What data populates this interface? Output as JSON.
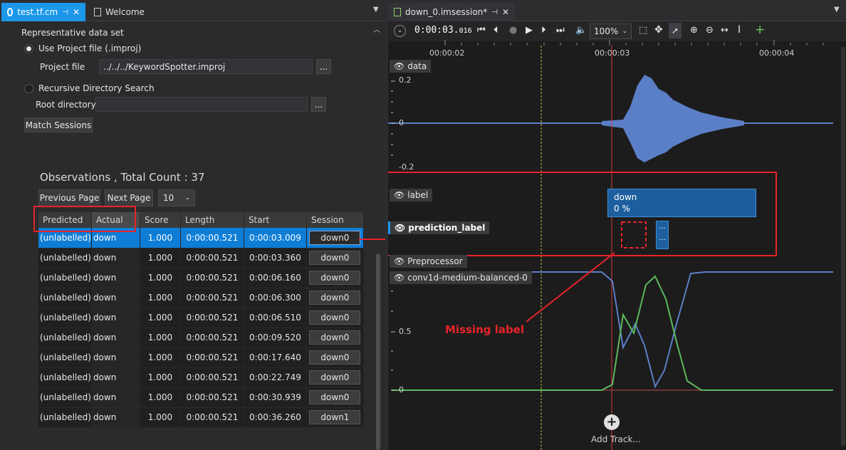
{
  "left_tabs": {
    "active": "test.tf.cm",
    "inactive": "Welcome"
  },
  "settings": {
    "section_title": "Representative data set",
    "use_project_file": "Use Project file (.improj)",
    "project_file_label": "Project file",
    "project_file_value": "../../../KeywordSpotter.improj",
    "browse": "...",
    "recursive_label": "Recursive Directory Search",
    "root_directory_label": "Root directory",
    "root_directory_value": "",
    "match_sessions": "Match Sessions"
  },
  "observations": {
    "title": "Observations , Total Count :  37",
    "previous_page": "Previous Page",
    "next_page": "Next Page",
    "page_size": "10",
    "columns": [
      "Predicted",
      "Actual",
      "Score",
      "Length",
      "Start",
      "Session"
    ],
    "rows": [
      {
        "predicted": "(unlabelled)",
        "actual": "down",
        "score": "1.000",
        "length": "0:00:00.521",
        "start": "0:00:03.009",
        "session": "down0"
      },
      {
        "predicted": "(unlabelled)",
        "actual": "down",
        "score": "1.000",
        "length": "0:00:00.521",
        "start": "0:00:03.360",
        "session": "down0"
      },
      {
        "predicted": "(unlabelled)",
        "actual": "down",
        "score": "1.000",
        "length": "0:00:00.521",
        "start": "0:00:06.160",
        "session": "down0"
      },
      {
        "predicted": "(unlabelled)",
        "actual": "down",
        "score": "1.000",
        "length": "0:00:00.521",
        "start": "0:00:06.300",
        "session": "down0"
      },
      {
        "predicted": "(unlabelled)",
        "actual": "down",
        "score": "1.000",
        "length": "0:00:00.521",
        "start": "0:00:06.510",
        "session": "down0"
      },
      {
        "predicted": "(unlabelled)",
        "actual": "down",
        "score": "1.000",
        "length": "0:00:00.521",
        "start": "0:00:09.520",
        "session": "down0"
      },
      {
        "predicted": "(unlabelled)",
        "actual": "down",
        "score": "1.000",
        "length": "0:00:00.521",
        "start": "0:00:17.640",
        "session": "down0"
      },
      {
        "predicted": "(unlabelled)",
        "actual": "down",
        "score": "1.000",
        "length": "0:00:00.521",
        "start": "0:00:22.749",
        "session": "down0"
      },
      {
        "predicted": "(unlabelled)",
        "actual": "down",
        "score": "1.000",
        "length": "0:00:00.521",
        "start": "0:00:30.939",
        "session": "down0"
      },
      {
        "predicted": "(unlabelled)",
        "actual": "down",
        "score": "1.000",
        "length": "0:00:00.521",
        "start": "0:00:36.260",
        "session": "down1"
      }
    ]
  },
  "session_tab": {
    "title": "down_0.imsession*"
  },
  "toolbar": {
    "timecode": "0:00:03.",
    "timecode_ms": "016",
    "zoom": "100%"
  },
  "timeline": {
    "ticks": [
      "00:00:02",
      "00:00:03",
      "00:00:04"
    ]
  },
  "tracks": {
    "data": "data",
    "data_y_top": "0.2",
    "data_y_mid": "0",
    "data_y_bottom": "-0.2",
    "label": "label",
    "label_segment_name": "down",
    "label_segment_value": "0 %",
    "prediction_label": "prediction_label",
    "prediction_ellipsis_1": "...",
    "prediction_ellipsis_2": "...",
    "preprocessor": "Preprocessor",
    "model": "conv1d-medium-balanced-0",
    "model_y_mid": "0.5",
    "model_y_zero": "0",
    "add_track": "Add Track..."
  },
  "annotation": {
    "missing_label": "Missing label",
    "color": "#e8242a"
  },
  "colors": {
    "accent": "#1c97ea",
    "selected_row": "#0e7dd6",
    "waveform": "#5b7fc7",
    "series_green": "#5cb85c",
    "playhead": "#d43c3c",
    "cursor": "#c9b458"
  }
}
